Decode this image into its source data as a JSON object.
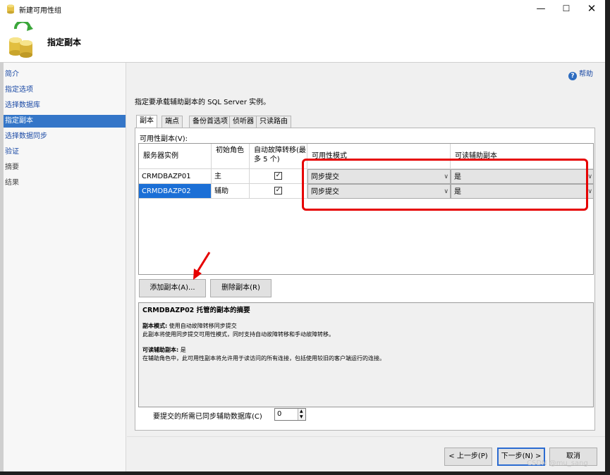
{
  "window": {
    "title": "新建可用性组",
    "header_title": "指定副本",
    "minimize_glyph": "—",
    "maximize_glyph": "☐",
    "close_glyph": "✕"
  },
  "nav": {
    "items": [
      {
        "label": "简介"
      },
      {
        "label": "指定选项"
      },
      {
        "label": "选择数据库"
      },
      {
        "label": "指定副本",
        "active": true
      },
      {
        "label": "选择数据同步"
      },
      {
        "label": "验证"
      },
      {
        "label": "摘要"
      },
      {
        "label": "结果"
      }
    ]
  },
  "help": {
    "label": "帮助",
    "icon": "help-icon"
  },
  "main": {
    "instruction": "指定要承载辅助副本的 SQL Server 实例。",
    "tabs": [
      {
        "label": "副本",
        "active": true
      },
      {
        "label": "端点"
      },
      {
        "label": "备份首选项"
      },
      {
        "label": "侦听器"
      },
      {
        "label": "只读路由"
      }
    ],
    "replicas_label": "可用性副本(V):",
    "grid": {
      "headers": [
        "服务器实例",
        "初始角色",
        "自动故障转移(最多 5 个)",
        "可用性模式",
        "可读辅助副本"
      ],
      "rows": [
        {
          "server": "CRMDBAZP01",
          "role": "主",
          "auto_failover": true,
          "mode": "同步提交",
          "readable": "是",
          "selected": false
        },
        {
          "server": "CRMDBAZP02",
          "role": "辅助",
          "auto_failover": true,
          "mode": "同步提交",
          "readable": "是",
          "selected": true
        }
      ]
    },
    "buttons": {
      "add_replica": "添加副本(A)...",
      "remove_replica": "删除副本(R)"
    },
    "summary": {
      "title": "CRMDBAZP02 托管的副本的摘要",
      "mode_label": "副本模式:",
      "mode_value": "使用自动故障转移同步提交",
      "mode_desc": "此副本将使用同步提交可用性模式，同时支持自动故障转移和手动故障转移。",
      "readable_label": "可读辅助副本:",
      "readable_value": "是",
      "readable_desc": "在辅助角色中，此可用性副本将允许用于读访问的所有连接，包括使用较旧的客户端运行的连接。"
    },
    "sync_label": "要提交的所需已同步辅助数据库(C)",
    "sync_value": "0"
  },
  "footer": {
    "prev": "< 上一步(P)",
    "next": "下一步(N) >",
    "cancel": "取消"
  },
  "watermark": "CSDN @mu_sang",
  "colors": {
    "selection": "#1b6fd6",
    "nav_active": "#3476c8",
    "annotation": "#e60000"
  }
}
